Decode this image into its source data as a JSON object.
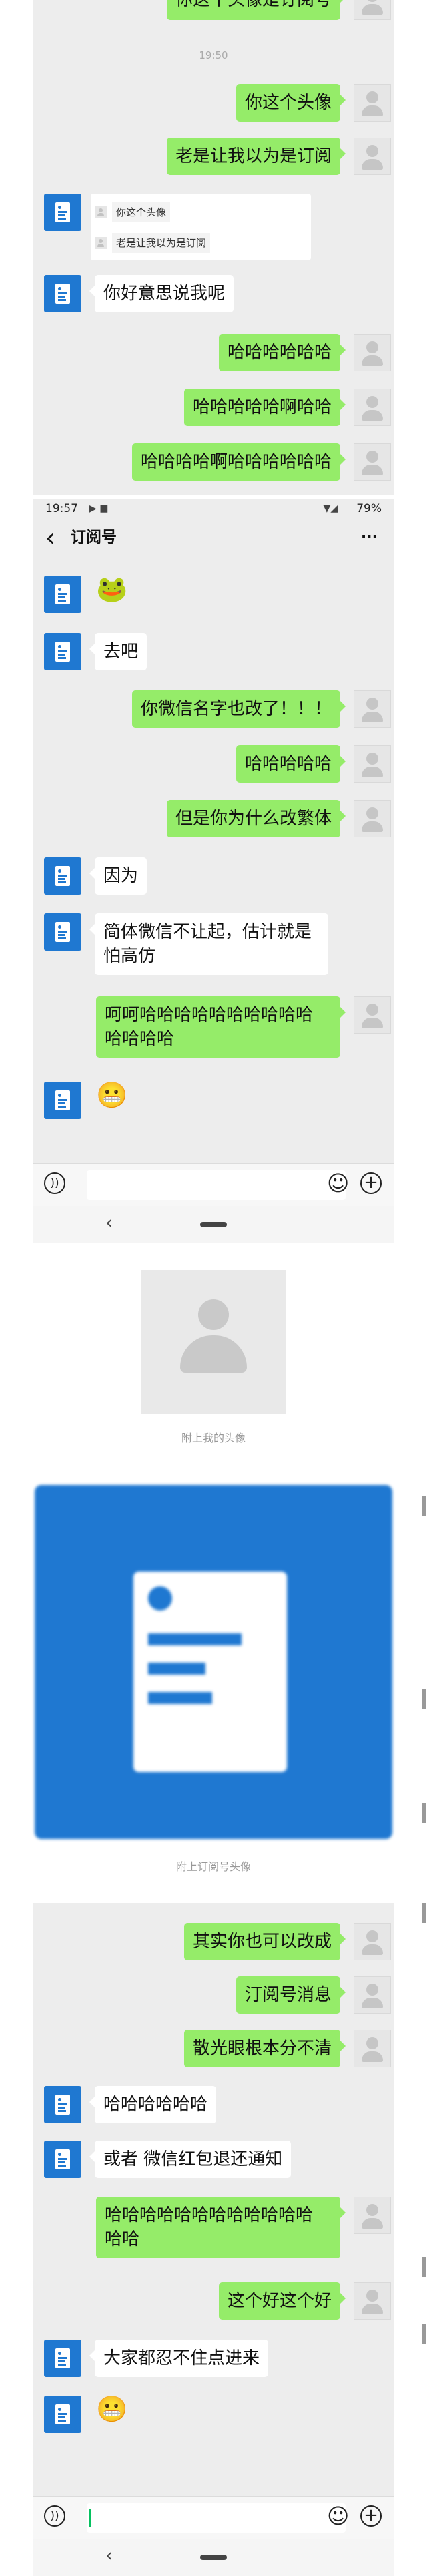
{
  "colors": {
    "chat_bg": "#ededed",
    "my_bubble": "#95ec69",
    "their_bubble": "#ffffff",
    "subscription_blue": "#1f78d1"
  },
  "panel1": {
    "top_bubble_text": "你这个头像是订阅号",
    "time": "19:50",
    "msg1": "你这个头像",
    "msg2": "老是让我以为是订阅",
    "quote_line1": "你这个头像",
    "quote_line2": "老是让我以为是订阅",
    "reply1": "你好意思说我呢",
    "msg3": "哈哈哈哈哈哈",
    "msg4": "哈哈哈哈哈啊哈哈",
    "msg5": "哈哈哈哈啊哈哈哈哈哈哈"
  },
  "panel2": {
    "status_time": "19:57",
    "battery": "79%",
    "back_icon": "‹",
    "title": "订阅号",
    "more_icon": "···",
    "sticker1": "🐸",
    "reply1": "去吧",
    "msg1": "你微信名字也改了！！！",
    "msg2": "哈哈哈哈哈",
    "msg3": "但是你为什么改繁体",
    "reply2": "因为",
    "reply3": "简体微信不让起，估计就是\n怕高仿",
    "msg4": "呵呵哈哈哈哈哈哈哈哈哈哈\n哈哈哈哈",
    "sticker2": "😬",
    "voice_icon": "))",
    "emoji_icon": "☺",
    "plus_icon": "+",
    "nav_back": "‹"
  },
  "images": {
    "my_avatar_caption": "附上我的头像",
    "sub_avatar_caption": "附上订阅号头像"
  },
  "panel3": {
    "msg1": "其实你也可以改成",
    "msg2": "汀阅号消息",
    "msg3": "散光眼根本分不清",
    "reply1": "哈哈哈哈哈哈",
    "reply2": "或者 微信红包退还通知",
    "msg4": "哈哈哈哈哈哈哈哈哈哈哈哈\n哈哈",
    "msg5": "这个好这个好",
    "reply3": "大家都忍不住点进来",
    "sticker": "😬",
    "voice_icon": "))",
    "emoji_icon": "☺",
    "plus_icon": "+",
    "nav_back": "‹"
  }
}
